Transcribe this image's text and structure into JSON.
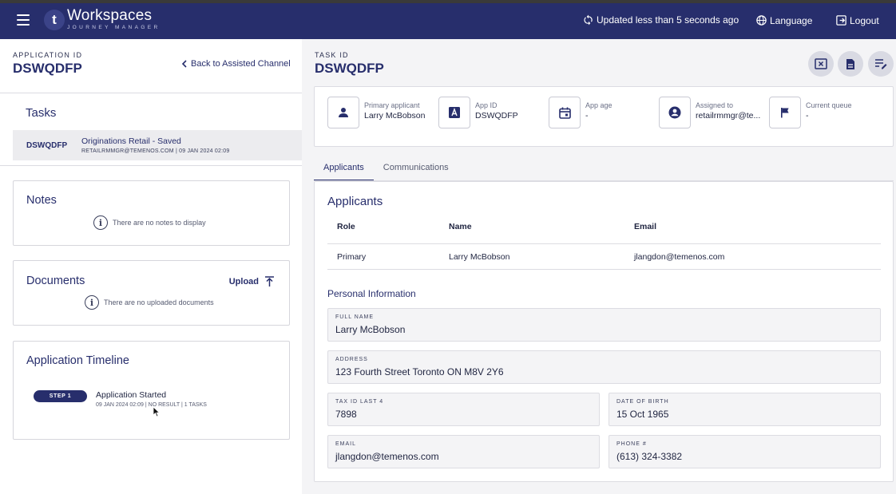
{
  "topbar": {
    "logo_letter": "t",
    "brand": "Workspaces",
    "brand_sub": "JOURNEY MANAGER",
    "updated": "Updated less than 5 seconds ago",
    "language": "Language",
    "logout": "Logout"
  },
  "left": {
    "app_id_label": "APPLICATION ID",
    "app_id": "DSWQDFP",
    "back_link": "Back to Assisted Channel",
    "tasks_title": "Tasks",
    "task": {
      "id": "DSWQDFP",
      "name": "Originations Retail - Saved",
      "meta": "RETAILRMMGR@TEMENOS.COM | 09 JAN 2024 02:09"
    },
    "notes": {
      "title": "Notes",
      "empty": "There are no notes to display"
    },
    "documents": {
      "title": "Documents",
      "upload": "Upload",
      "empty": "There are no uploaded documents"
    },
    "timeline": {
      "title": "Application Timeline",
      "step": "STEP 1",
      "event": "Application Started",
      "meta": "09 JAN 2024 02:09 | NO RESULT | 1 TASKS"
    }
  },
  "right": {
    "task_id_label": "TASK ID",
    "task_id": "DSWQDFP",
    "summary": [
      {
        "icon": "person-icon",
        "label": "Primary applicant",
        "value": "Larry McBobson"
      },
      {
        "icon": "app-id-icon",
        "label": "App ID",
        "value": "DSWQDFP"
      },
      {
        "icon": "calendar-icon",
        "label": "App age",
        "value": "-"
      },
      {
        "icon": "account-circle-icon",
        "label": "Assigned to",
        "value": "retailrmmgr@te..."
      },
      {
        "icon": "flag-icon",
        "label": "Current queue",
        "value": "-"
      }
    ],
    "tabs": [
      "Applicants",
      "Communications"
    ],
    "applicants": {
      "title": "Applicants",
      "columns": [
        "Role",
        "Name",
        "Email"
      ],
      "rows": [
        {
          "role": "Primary",
          "name": "Larry McBobson",
          "email": "jlangdon@temenos.com"
        }
      ]
    },
    "personal": {
      "title": "Personal Information",
      "full_name_label": "FULL NAME",
      "full_name": "Larry McBobson",
      "address_label": "ADDRESS",
      "address": "123 Fourth Street Toronto ON M8V 2Y6",
      "tax_label": "TAX ID LAST 4",
      "tax": "7898",
      "dob_label": "DATE OF BIRTH",
      "dob": "15 Oct 1965",
      "email_label": "EMAIL",
      "email": "jlangdon@temenos.com",
      "phone_label": "PHONE #",
      "phone": "(613) 324-3382"
    }
  },
  "colors": {
    "brand_navy": "#272e6c",
    "panel_bg": "#f4f4f6"
  }
}
